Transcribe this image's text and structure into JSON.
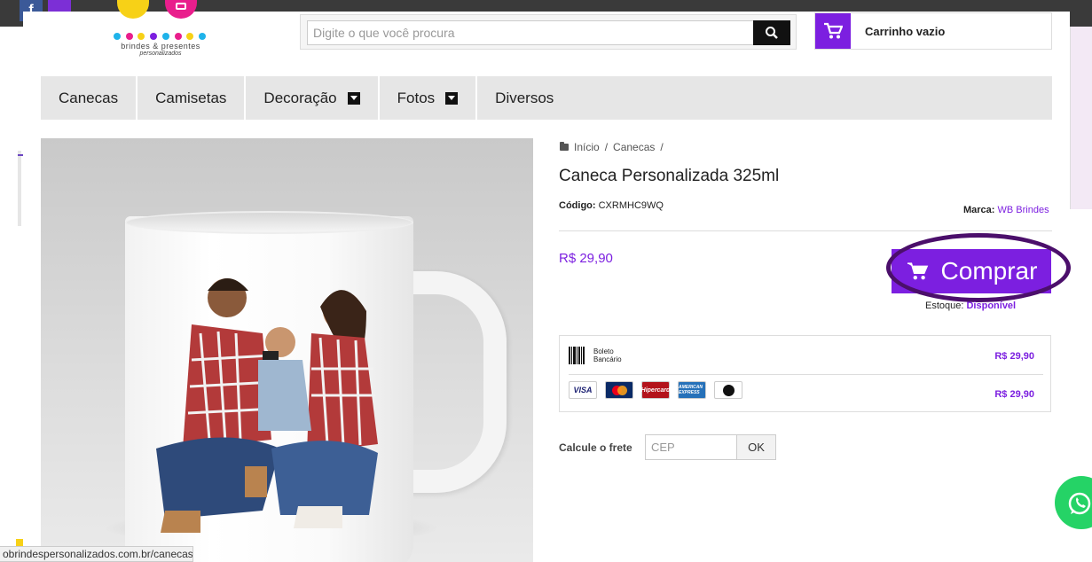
{
  "search": {
    "placeholder": "Digite o que você procura"
  },
  "cart": {
    "label": "Carrinho vazio"
  },
  "nav": {
    "items": [
      {
        "label": "Canecas"
      },
      {
        "label": "Camisetas"
      },
      {
        "label": "Decoração"
      },
      {
        "label": "Fotos"
      },
      {
        "label": "Diversos"
      }
    ]
  },
  "breadcrumb": {
    "home": "Início",
    "separator": "/",
    "category": "Canecas"
  },
  "product": {
    "title": "Caneca Personalizada 325ml",
    "code_label": "Código:",
    "code_value": "CXRMHC9WQ",
    "brand_label": "Marca:",
    "brand_value": "WB Brindes",
    "price": "R$ 29,90",
    "buy_label": "Comprar",
    "stock_label": "Estoque:",
    "stock_value": "Disponível"
  },
  "payment": {
    "boleto_line1": "Boleto",
    "boleto_line2": "Bancário",
    "boleto_value": "R$ 29,90",
    "cards_value": "R$ 29,90",
    "card_labels": {
      "visa": "VISA",
      "hipercard": "Hipercard",
      "amex": "AMERICAN EXPRESS"
    }
  },
  "freight": {
    "label": "Calcule o frete",
    "cep_placeholder": "CEP",
    "button": "OK"
  },
  "logo": {
    "line1": "brindes & presentes",
    "line2": "personalizados"
  },
  "status_bar": {
    "url": "obrindespersonalizados.com.br/canecas"
  },
  "colors": {
    "accent": "#7c1fe0",
    "highlight_ring": "#4b0f6b",
    "whatsapp": "#25d366"
  }
}
